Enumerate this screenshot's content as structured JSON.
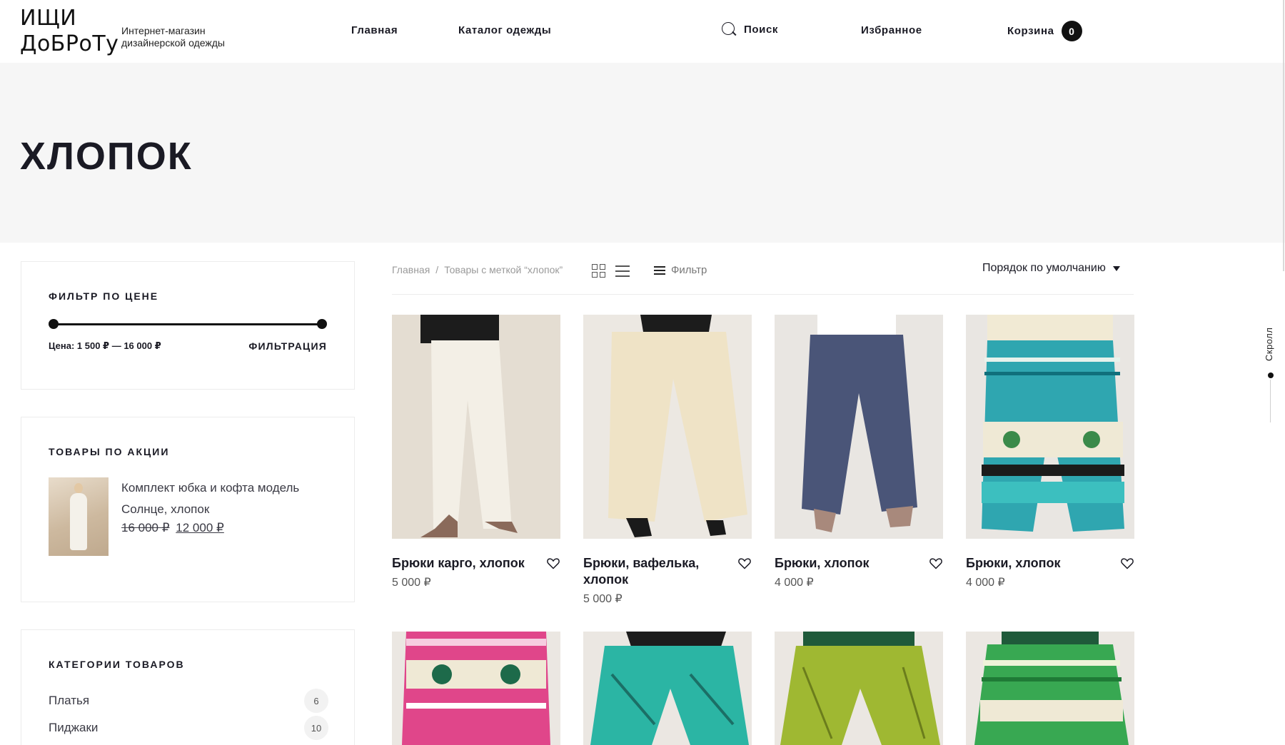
{
  "header": {
    "logo_line1": "ИЩИ",
    "logo_line2": "ДоБРоТу",
    "tagline_line1": "Интернет-магазин",
    "tagline_line2": "дизайнерской одежды",
    "nav": [
      {
        "label": "Главная"
      },
      {
        "label": "Каталог одежды"
      }
    ],
    "search_label": "Поиск",
    "favorites_label": "Избранное",
    "cart_label": "Корзина",
    "cart_count": "0"
  },
  "hero": {
    "title": "ХЛОПОК"
  },
  "scroll": {
    "label": "Скролл"
  },
  "sidebar": {
    "price_filter": {
      "title": "ФИЛЬТР ПО ЦЕНЕ",
      "price_text": "Цена: 1 500 ₽ — 16 000 ₽",
      "min_price": 1500,
      "max_price": 16000,
      "button_label": "ФИЛЬТРАЦИЯ"
    },
    "promo": {
      "title": "ТОВАРЫ ПО АКЦИИ",
      "product_title": "Комплект юбка и кофта модель Солнце, хлопок",
      "old_price": "16 000 ₽",
      "new_price": "12 000 ₽"
    },
    "categories": {
      "title": "КАТЕГОРИИ ТОВАРОВ",
      "items": [
        {
          "name": "Платья",
          "count": "6"
        },
        {
          "name": "Пиджаки",
          "count": "10"
        }
      ]
    }
  },
  "toolbar": {
    "breadcrumb_home": "Главная",
    "breadcrumb_separator": "/",
    "breadcrumb_current": "Товары с меткой “хлопок”",
    "filter_label": "Фильтр",
    "sort_label": "Порядок по умолчанию"
  },
  "products": [
    {
      "title": "Брюки карго, хлопок",
      "price": "5 000 ₽",
      "color": "#efe9dd"
    },
    {
      "title": "Брюки, вафелька, хлопок",
      "price": "5 000 ₽",
      "color": "#ede0c2"
    },
    {
      "title": "Брюки, хлопок",
      "price": "4 000 ₽",
      "color": "#4a5578"
    },
    {
      "title": "Брюки, хлопок",
      "price": "4 000 ₽",
      "color": "#2fa6b0"
    }
  ],
  "products_row2": [
    {
      "color": "#e0468a"
    },
    {
      "color": "#2bb5a4"
    },
    {
      "color": "#9fb832"
    },
    {
      "color": "#38a852"
    }
  ],
  "colors": {
    "hero_bg": "#f6f6f6",
    "text_dark": "#1a1a24",
    "badge_bg": "#111111"
  }
}
